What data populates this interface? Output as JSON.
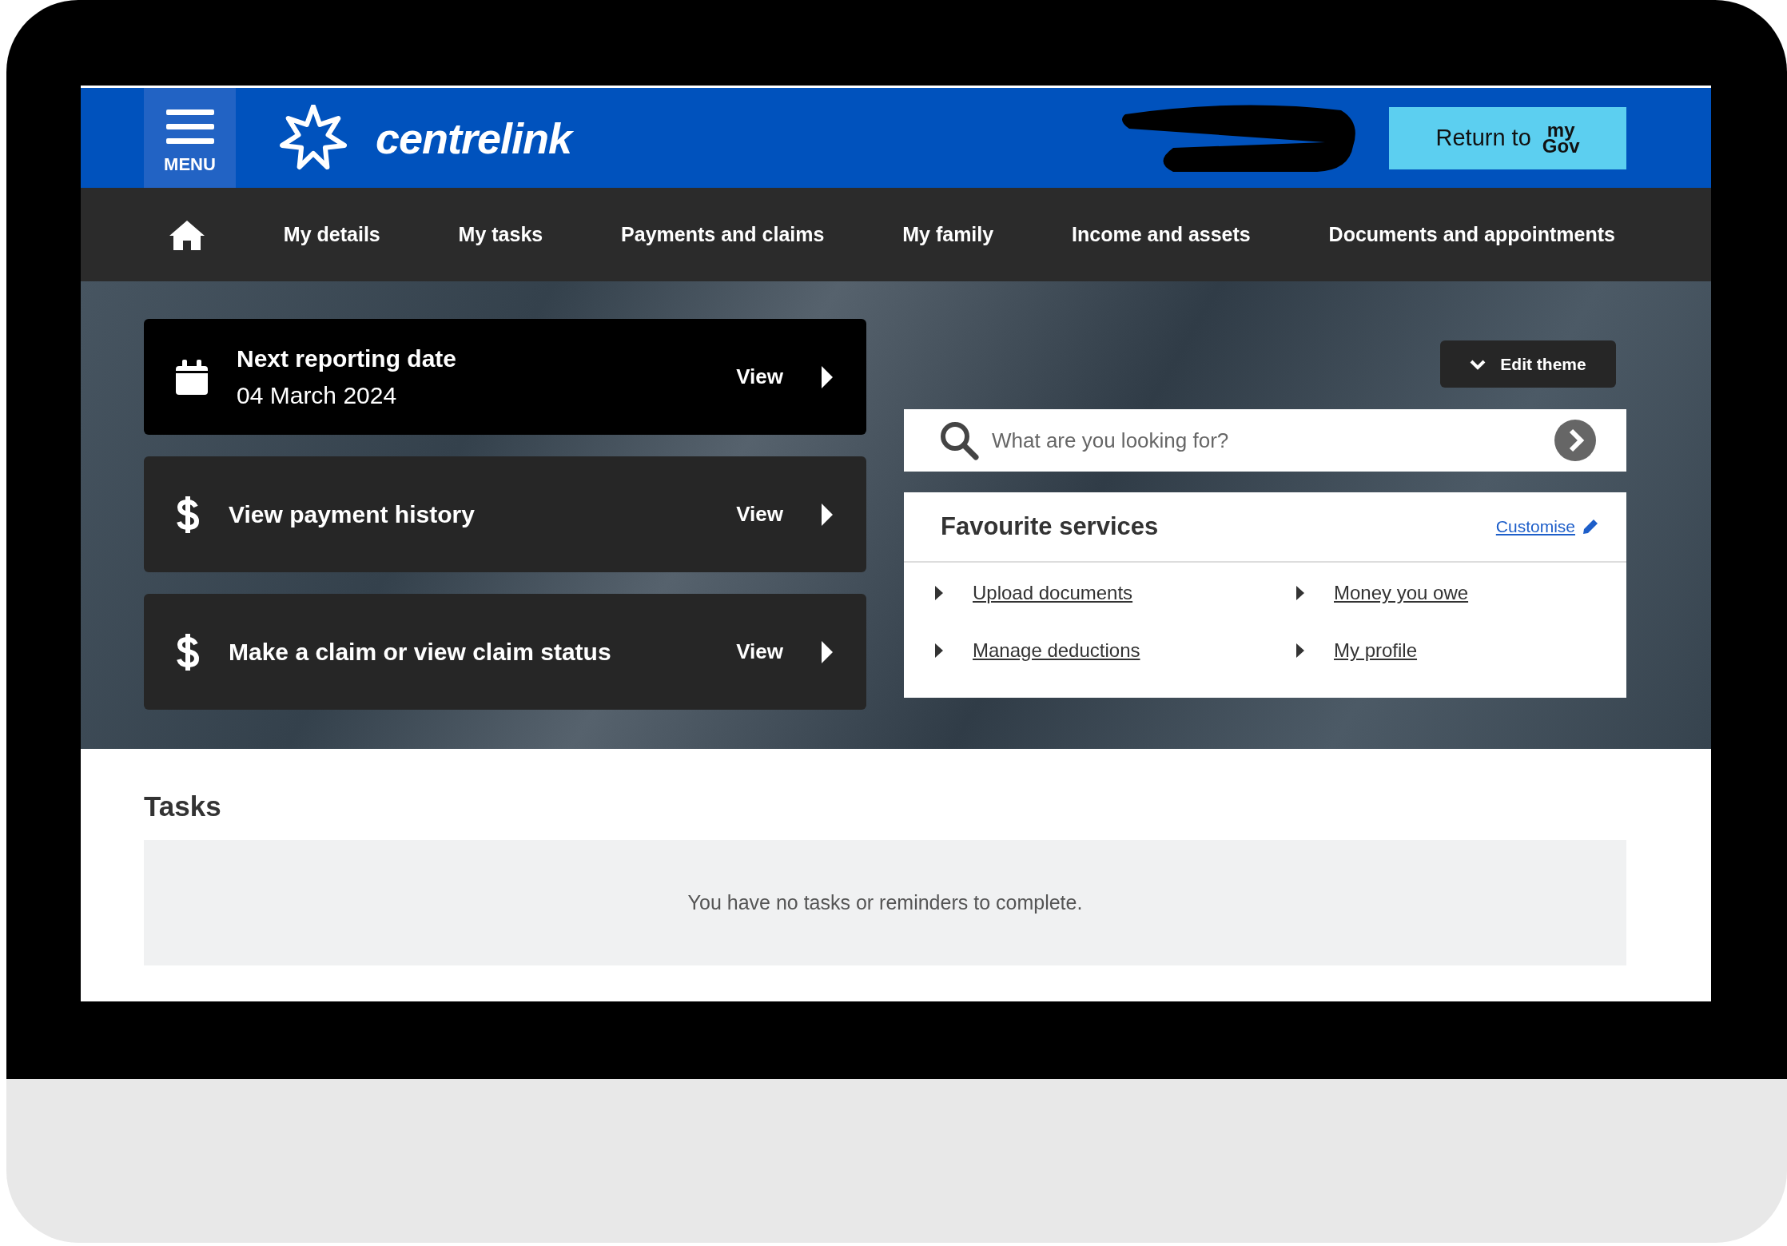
{
  "header": {
    "menu_label": "MENU",
    "brand": "centrelink",
    "return_button": {
      "label": "Return to",
      "logo_top": "my",
      "logo_bottom": "Gov"
    }
  },
  "nav": {
    "items": [
      "My details",
      "My tasks",
      "Payments and claims",
      "My family",
      "Income and assets",
      "Documents and appointments"
    ]
  },
  "cards": [
    {
      "kind": "date",
      "title": "Next reporting date",
      "subtitle": "04 March 2024",
      "action": "View"
    },
    {
      "kind": "payment",
      "title": "View payment history",
      "action": "View"
    },
    {
      "kind": "payment",
      "title": "Make a claim or view claim status",
      "action": "View"
    }
  ],
  "edit_theme": "Edit theme",
  "search": {
    "placeholder": "What are you looking for?"
  },
  "favourites": {
    "title": "Favourite services",
    "customise": "Customise",
    "links": [
      "Upload documents",
      "Money you owe",
      "Manage deductions",
      "My profile"
    ]
  },
  "tasks": {
    "title": "Tasks",
    "empty_message": "You have no tasks or reminders to complete."
  }
}
